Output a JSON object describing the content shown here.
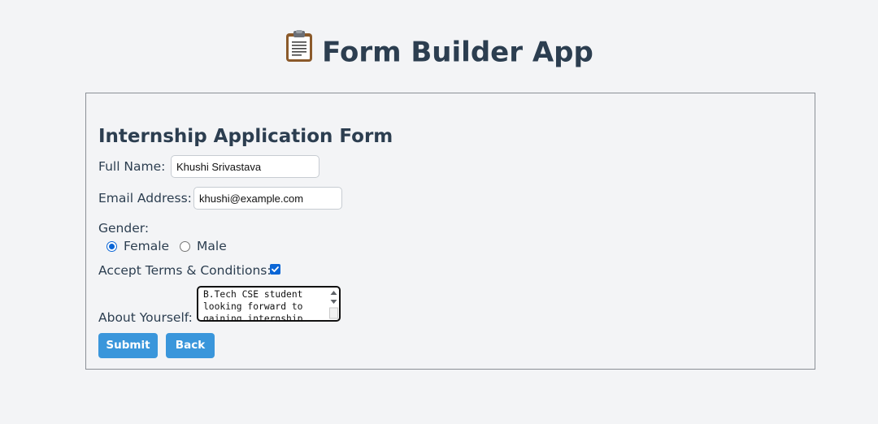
{
  "app": {
    "title": "Form Builder App",
    "icon": "clipboard-icon"
  },
  "form": {
    "title": "Internship Application Form",
    "full_name": {
      "label": "Full Name:",
      "value": "Khushi Srivastava"
    },
    "email": {
      "label": "Email Address:",
      "value": "khushi@example.com"
    },
    "gender": {
      "label": "Gender:",
      "options": [
        "Female",
        "Male"
      ],
      "selected": "Female"
    },
    "terms": {
      "label": "Accept Terms & Conditions:",
      "checked": true
    },
    "about": {
      "label": "About Yourself:",
      "value": "B.Tech CSE student looking forward to gaining internship"
    },
    "buttons": {
      "submit": "Submit",
      "back": "Back"
    }
  },
  "colors": {
    "background": "#f3f4f6",
    "heading": "#2c3e50",
    "button": "#3a96db",
    "accent": "#0b66d6"
  }
}
